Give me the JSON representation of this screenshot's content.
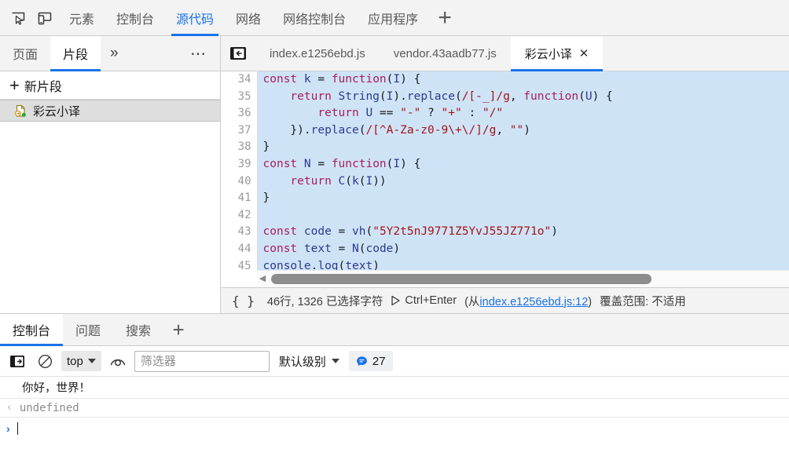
{
  "main_tabbar": {
    "icons": [
      {
        "name": "inspect-element-icon",
        "title": "检查"
      },
      {
        "name": "device-toolbar-icon",
        "title": "设备工具栏"
      }
    ],
    "tabs": [
      {
        "label": "元素",
        "active": false
      },
      {
        "label": "控制台",
        "active": false
      },
      {
        "label": "源代码",
        "active": true
      },
      {
        "label": "网络",
        "active": false
      },
      {
        "label": "网络控制台",
        "active": false
      },
      {
        "label": "应用程序",
        "active": false
      }
    ],
    "add_label": "+"
  },
  "navigator": {
    "tabs": [
      {
        "label": "页面",
        "active": false
      },
      {
        "label": "片段",
        "active": true
      }
    ],
    "more_label": "»",
    "dots_label": "⋯",
    "new_snippet": {
      "plus": "+",
      "label": "新片段"
    },
    "snippets": [
      {
        "label": "彩云小译",
        "icon": "snippet-file-icon",
        "selected": true
      }
    ]
  },
  "editor": {
    "back_icon": "back-arrow-icon",
    "tabs": [
      {
        "label": "index.e1256ebd.js",
        "active": false,
        "closable": false
      },
      {
        "label": "vendor.43aadb77.js",
        "active": false,
        "closable": false
      },
      {
        "label": "彩云小译",
        "active": true,
        "closable": true,
        "close_label": "✕"
      }
    ],
    "code_lines": [
      {
        "num": "34",
        "tokens": [
          {
            "t": "const ",
            "c": "k-kw"
          },
          {
            "t": "k",
            "c": "k-id"
          },
          {
            "t": " = ",
            "c": "k-plain"
          },
          {
            "t": "function",
            "c": "k-kw"
          },
          {
            "t": "(",
            "c": "k-plain"
          },
          {
            "t": "I",
            "c": "k-id"
          },
          {
            "t": ") {",
            "c": "k-plain"
          }
        ]
      },
      {
        "num": "35",
        "tokens": [
          {
            "t": "    ",
            "c": "k-plain"
          },
          {
            "t": "return ",
            "c": "k-kw"
          },
          {
            "t": "String",
            "c": "k-id"
          },
          {
            "t": "(",
            "c": "k-plain"
          },
          {
            "t": "I",
            "c": "k-id"
          },
          {
            "t": ").",
            "c": "k-plain"
          },
          {
            "t": "replace",
            "c": "k-id"
          },
          {
            "t": "(",
            "c": "k-plain"
          },
          {
            "t": "/[-_]/g",
            "c": "k-str"
          },
          {
            "t": ", ",
            "c": "k-plain"
          },
          {
            "t": "function",
            "c": "k-kw"
          },
          {
            "t": "(",
            "c": "k-plain"
          },
          {
            "t": "U",
            "c": "k-id"
          },
          {
            "t": ") {",
            "c": "k-plain"
          }
        ]
      },
      {
        "num": "36",
        "tokens": [
          {
            "t": "        ",
            "c": "k-plain"
          },
          {
            "t": "return ",
            "c": "k-kw"
          },
          {
            "t": "U",
            "c": "k-id"
          },
          {
            "t": " == ",
            "c": "k-plain"
          },
          {
            "t": "\"-\"",
            "c": "k-str"
          },
          {
            "t": " ? ",
            "c": "k-plain"
          },
          {
            "t": "\"+\"",
            "c": "k-str"
          },
          {
            "t": " : ",
            "c": "k-plain"
          },
          {
            "t": "\"/\"",
            "c": "k-str"
          }
        ]
      },
      {
        "num": "37",
        "tokens": [
          {
            "t": "    }).",
            "c": "k-plain"
          },
          {
            "t": "replace",
            "c": "k-id"
          },
          {
            "t": "(",
            "c": "k-plain"
          },
          {
            "t": "/[^A-Za-z0-9\\+\\/]/g",
            "c": "k-str"
          },
          {
            "t": ", ",
            "c": "k-plain"
          },
          {
            "t": "\"\"",
            "c": "k-str"
          },
          {
            "t": ")",
            "c": "k-plain"
          }
        ]
      },
      {
        "num": "38",
        "tokens": [
          {
            "t": "}",
            "c": "k-plain"
          }
        ]
      },
      {
        "num": "39",
        "tokens": [
          {
            "t": "const ",
            "c": "k-kw"
          },
          {
            "t": "N",
            "c": "k-id"
          },
          {
            "t": " = ",
            "c": "k-plain"
          },
          {
            "t": "function",
            "c": "k-kw"
          },
          {
            "t": "(",
            "c": "k-plain"
          },
          {
            "t": "I",
            "c": "k-id"
          },
          {
            "t": ") {",
            "c": "k-plain"
          }
        ]
      },
      {
        "num": "40",
        "tokens": [
          {
            "t": "    ",
            "c": "k-plain"
          },
          {
            "t": "return ",
            "c": "k-kw"
          },
          {
            "t": "C",
            "c": "k-id"
          },
          {
            "t": "(",
            "c": "k-plain"
          },
          {
            "t": "k",
            "c": "k-id"
          },
          {
            "t": "(",
            "c": "k-plain"
          },
          {
            "t": "I",
            "c": "k-id"
          },
          {
            "t": "))",
            "c": "k-plain"
          }
        ]
      },
      {
        "num": "41",
        "tokens": [
          {
            "t": "}",
            "c": "k-plain"
          }
        ]
      },
      {
        "num": "42",
        "tokens": [
          {
            "t": "",
            "c": "k-plain"
          }
        ]
      },
      {
        "num": "43",
        "tokens": [
          {
            "t": "const ",
            "c": "k-kw"
          },
          {
            "t": "code",
            "c": "k-id"
          },
          {
            "t": " = ",
            "c": "k-plain"
          },
          {
            "t": "vh",
            "c": "k-id"
          },
          {
            "t": "(",
            "c": "k-plain"
          },
          {
            "t": "\"5Y2t5nJ9771Z5YvJ55JZ771o\"",
            "c": "k-str"
          },
          {
            "t": ")",
            "c": "k-plain"
          }
        ]
      },
      {
        "num": "44",
        "tokens": [
          {
            "t": "const ",
            "c": "k-kw"
          },
          {
            "t": "text",
            "c": "k-id"
          },
          {
            "t": " = ",
            "c": "k-plain"
          },
          {
            "t": "N",
            "c": "k-id"
          },
          {
            "t": "(",
            "c": "k-plain"
          },
          {
            "t": "code",
            "c": "k-id"
          },
          {
            "t": ")",
            "c": "k-plain"
          }
        ]
      },
      {
        "num": "45",
        "tokens": [
          {
            "t": "console",
            "c": "k-id"
          },
          {
            "t": ".",
            "c": "k-plain"
          },
          {
            "t": "log",
            "c": "k-id"
          },
          {
            "t": "(",
            "c": "k-plain"
          },
          {
            "t": "text",
            "c": "k-id"
          },
          {
            "t": ")",
            "c": "k-plain"
          }
        ]
      }
    ],
    "status": {
      "braces": "{ }",
      "position": "46行, 1326 已选择字符",
      "run_shortcut": "Ctrl+Enter",
      "run_from_prefix": "(从",
      "run_from_link": "index.e1256ebd.js:12",
      "run_from_suffix": ")",
      "coverage": "覆盖范围: 不适用"
    }
  },
  "drawer": {
    "tabs": [
      {
        "label": "控制台",
        "active": true
      },
      {
        "label": "问题",
        "active": false
      },
      {
        "label": "搜索",
        "active": false
      }
    ],
    "add_label": "+",
    "toolbar": {
      "sidebar_icon": "console-sidebar-icon",
      "clear_icon": "clear-console-icon",
      "context_value": "top",
      "eye_icon": "live-expression-icon",
      "filter_placeholder": "筛选器",
      "filter_value": "",
      "level_label": "默认级别",
      "message_count": "27",
      "message_icon": "message-bubble-icon"
    },
    "console_messages": [
      {
        "type": "log",
        "text": "你好，世界！"
      },
      {
        "type": "result",
        "marker": "‹",
        "text": "undefined"
      }
    ],
    "prompt": {
      "marker": "›",
      "value": ""
    }
  },
  "colors": {
    "accent": "#1a73e8",
    "selection": "#cfe3f7",
    "toolbar_bg": "#f3f3f3",
    "border": "#cdcdcd",
    "keyword": "#a71d5d",
    "identifier": "#2b3a8c",
    "string": "#a31515",
    "snippet_selected_bg": "#dedede"
  }
}
